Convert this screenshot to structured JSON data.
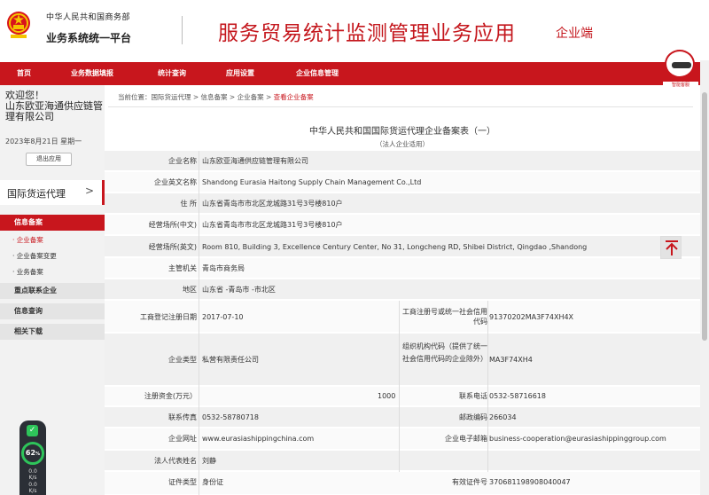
{
  "header": {
    "gov_name": "中华人民共和国商务部",
    "platform_name": "业务系统统一平台",
    "app_title": "服务贸易统计监测管理业务应用",
    "app_sub": "企业端",
    "robot_label": "智能客服"
  },
  "nav": {
    "items": [
      "首页",
      "业务数据填报",
      "统计查询",
      "应用设置",
      "企业信息管理"
    ]
  },
  "sidebar": {
    "welcome": "欢迎您！",
    "company": "山东欧亚海通供应链管理有限公司",
    "date": "2023年8月21日 星期一",
    "logout_label": "退出应用",
    "agent_tab": "国际货运代理",
    "agent_tab_arrow": ">",
    "menu": {
      "info_record": "信息备案",
      "sub": [
        "· 企业备案",
        "· 企业备案变更",
        "· 业务备案"
      ],
      "key_contact": "重点联系企业",
      "info_query": "信息查询",
      "downloads": "相关下载"
    }
  },
  "speed": {
    "percent": "62",
    "unit": "%",
    "up": "0.0",
    "up_unit": "K/s",
    "down": "0.0",
    "down_unit": "K/s"
  },
  "breadcrumb": {
    "prefix": "当前位置：",
    "path": "国际货运代理 > 信息备案 > 企业备案 > ",
    "current": "查看企业备案"
  },
  "form": {
    "title": "中华人民共和国国际货运代理企业备案表（一）",
    "subtitle": "（法人企业适用）",
    "name_label": "企业名称",
    "name_value": "山东欧亚海通供应链管理有限公司",
    "en_name_label": "企业英文名称",
    "en_name_value": "Shandong Eurasia Haitong Supply Chain Management Co.,Ltd",
    "address_label": "住 所",
    "address_value": "山东省青岛市市北区龙城路31号3号楼810户",
    "biz_cn_label": "经营场所(中文)",
    "biz_cn_value": "山东省青岛市市北区龙城路31号3号楼810户",
    "biz_en_label": "经营场所(英文)",
    "biz_en_value": "Room 810, Building 3, Excellence Century Center, No 31, Longcheng RD, Shibei District, Qingdao ,Shandong",
    "authority_label": "主管机关",
    "authority_value": "青岛市商务局",
    "region_label": "地区",
    "region_value": "山东省 -青岛市 -市北区",
    "reg_date_label": "工商登记注册日期",
    "reg_date_value": "2017-07-10",
    "reg_no_label": "工商注册号或统一社会信用代码",
    "reg_no_value": "91370202MA3F74XH4X",
    "type_label": "企业类型",
    "type_value": "私营有限责任公司",
    "org_code_label": "组织机构代码（提供了统一社会信用代码的企业除外）",
    "org_code_value": "MA3F74XH4",
    "capital_label": "注册资金(万元）",
    "capital_value": "1000",
    "phone_label": "联系电话",
    "phone_value": "0532-58716618",
    "fax_label": "联系传真",
    "fax_value": "0532-58780718",
    "zip_label": "邮政编码",
    "zip_value": "266034",
    "website_label": "企业网址",
    "website_value": "www.eurasiashippingchina.com",
    "email_label": "企业电子邮箱",
    "email_value": "business-cooperation@eurasiashippinggroup.com",
    "rep_label": "法人代表姓名",
    "rep_value": "刘静",
    "id_type_label": "证件类型",
    "id_type_value": "身份证",
    "id_no_label": "有效证件号",
    "id_no_value": "370681198908040047"
  },
  "icons": {
    "to_top": "arrow-up-icon"
  },
  "colors": {
    "brand_red": "#c8161d",
    "success_green": "#2ec45a"
  }
}
